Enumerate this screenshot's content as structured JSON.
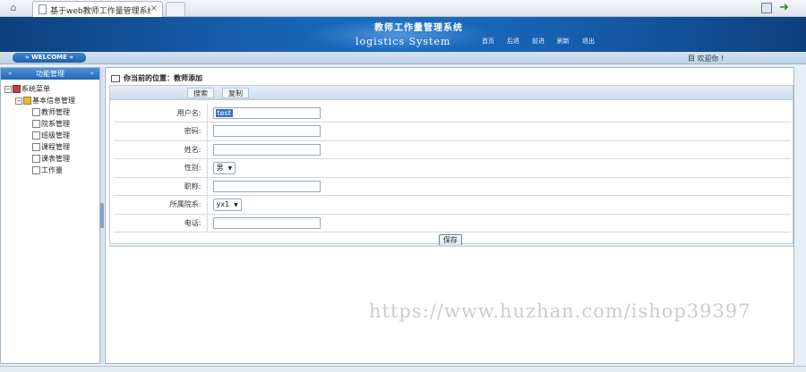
{
  "browser": {
    "tab_title": "基于web教师工作量管理系统",
    "tab_close": "×"
  },
  "header": {
    "cn_title": "教师工作量管理系统",
    "en_title": "logistics System",
    "nav": [
      "首页",
      "后退",
      "前进",
      "刷新",
      "退出"
    ]
  },
  "welcome": {
    "label": "» WELCOME «",
    "greeting": "目 欢迎你 !"
  },
  "sidebar": {
    "title": "功能管理",
    "tree": {
      "root": "系统菜单",
      "group": "基本信息管理",
      "items": [
        "教师管理",
        "院系管理",
        "班级管理",
        "课程管理",
        "课表管理",
        "工作量"
      ]
    }
  },
  "main": {
    "breadcrumb": "你当前的位置：教师添加",
    "toolbar": [
      "搜索",
      "复制"
    ],
    "form": {
      "username_label": "用户名:",
      "username_value": "test",
      "password_label": "密码:",
      "name_label": "姓名:",
      "gender_label": "性别:",
      "gender_value": "男",
      "title_label": "职称:",
      "dept_label": "所属院系:",
      "dept_value": "yx1",
      "phone_label": "电话:"
    },
    "save_label": "保存"
  },
  "watermark": "https://www.huzhan.com/ishop39397"
}
